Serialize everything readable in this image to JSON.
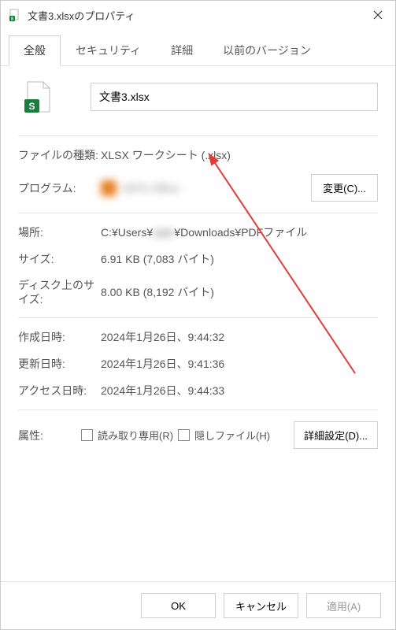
{
  "window": {
    "title": "文書3.xlsxのプロパティ"
  },
  "tabs": {
    "general": "全般",
    "security": "セキュリティ",
    "details": "詳細",
    "versions": "以前のバージョン"
  },
  "file": {
    "name": "文書3.xlsx",
    "type_label": "ファイルの種類:",
    "type_value": "XLSX ワークシート (.xlsx)",
    "program_label": "プログラム:",
    "program_app": "WPS Office",
    "change_btn": "変更(C)...",
    "location_label": "場所:",
    "location_prefix": "C:¥Users¥",
    "location_blurred": "user",
    "location_suffix": "¥Downloads¥PDFファイル",
    "size_label": "サイズ:",
    "size_value": "6.91 KB (7,083 バイト)",
    "disk_label": "ディスク上のサイズ:",
    "disk_value": "8.00 KB (8,192 バイト)",
    "created_label": "作成日時:",
    "created_value": "2024年1月26日、9:44:32",
    "modified_label": "更新日時:",
    "modified_value": "2024年1月26日、9:41:36",
    "accessed_label": "アクセス日時:",
    "accessed_value": "2024年1月26日、9:44:33",
    "attr_label": "属性:",
    "readonly_label": "読み取り専用(R)",
    "hidden_label": "隠しファイル(H)",
    "advanced_btn": "詳細設定(D)..."
  },
  "buttons": {
    "ok": "OK",
    "cancel": "キャンセル",
    "apply": "適用(A)"
  }
}
